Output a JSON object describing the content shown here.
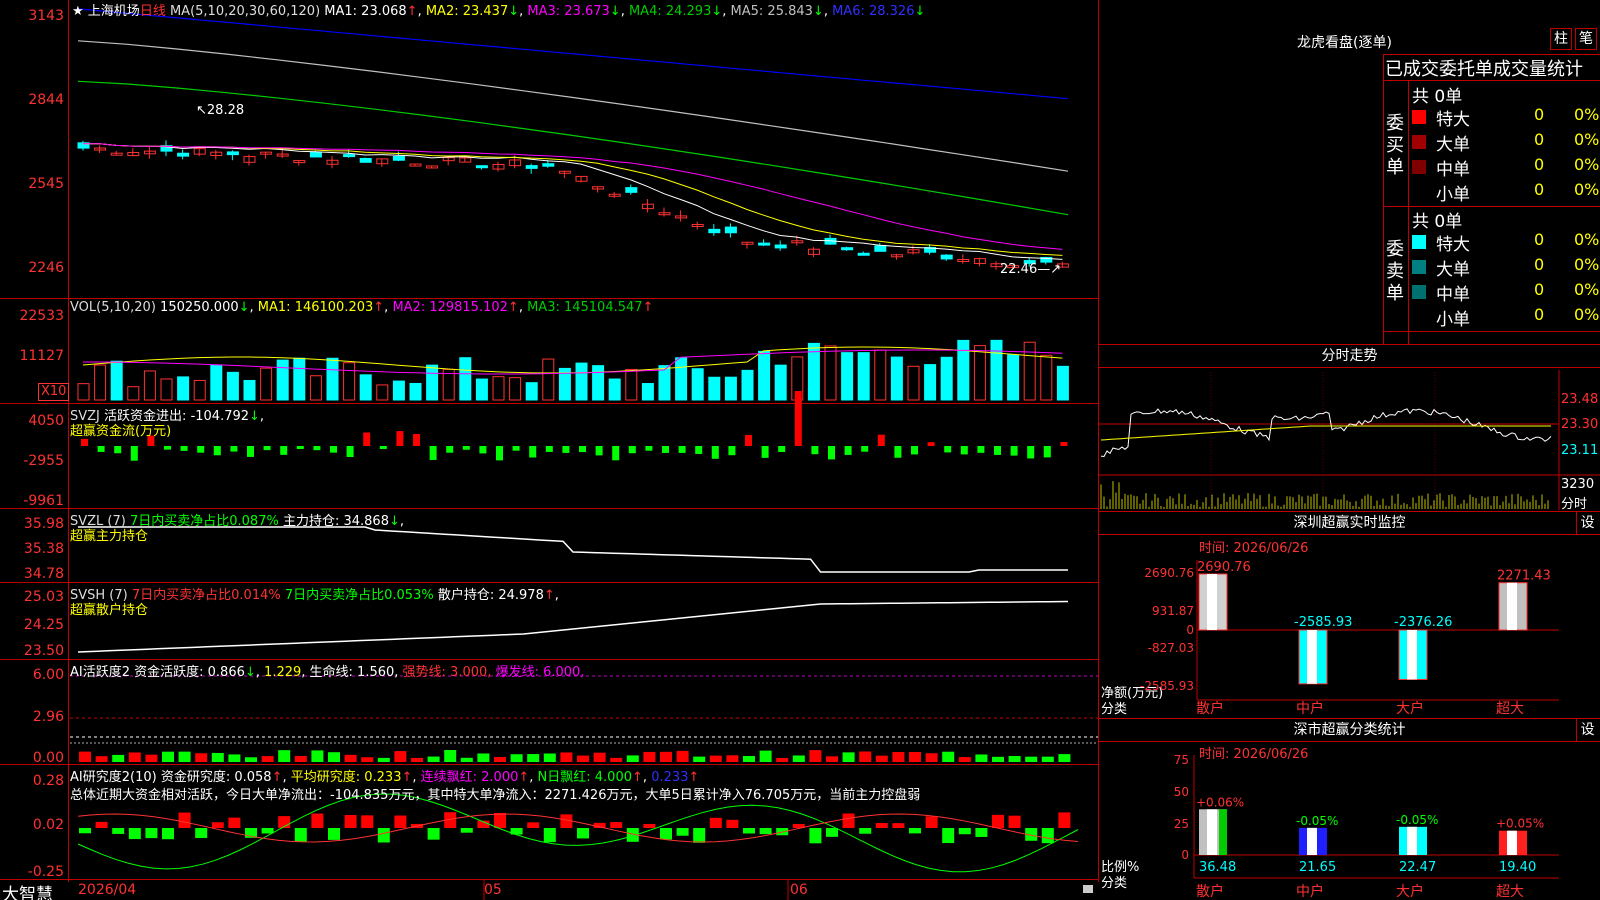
{
  "colors": {
    "up": "#ff3232",
    "down": "#00ffff",
    "grid": "#c00000",
    "ma1": "#ffffff",
    "ma2": "#ffff00",
    "ma3": "#ff00ff",
    "ma4": "#00cc00",
    "ma5": "#c0c0c0",
    "ma6": "#0000ff"
  },
  "main": {
    "star": "★",
    "stock": "上海机场",
    "period": "日线",
    "ma_title": "MA(5,10,20,30,60,120)",
    "ma1": "MA1: 23.068",
    "ma2": "MA2: 23.437",
    "ma3": "MA3: 23.673",
    "ma4": "MA4: 24.293",
    "ma5": "MA5: 25.843",
    "ma6": "MA6: 28.326",
    "y_labels": [
      "3143",
      "2844",
      "2545",
      "2246"
    ],
    "high_label": "28.28",
    "low_label": "22.46"
  },
  "vol": {
    "title": "VOL(5,10,20)",
    "value": "150250.000",
    "ma1": "MA1: 146100.203",
    "ma2": "MA2: 129815.102",
    "ma3": "MA3: 145104.547",
    "y_labels": [
      "22533",
      "11127"
    ],
    "unit": "X10"
  },
  "svzj": {
    "title": "SVZJ",
    "label": "活跃资金进出:",
    "value": "-104.792",
    "sub": "超赢资金流(万元)",
    "y_labels": [
      "4050",
      "-2955",
      "-9961"
    ]
  },
  "svzl": {
    "title": "SVZL (7)",
    "ratio": "7日内买卖净占比0.087%",
    "hold": "主力持仓: 34.868",
    "sub": "超赢主力持仓",
    "y_labels": [
      "35.98",
      "35.38",
      "34.78"
    ]
  },
  "svsh": {
    "title": "SVSH (7)",
    "ratio1": "7日内买卖净占比0.014%",
    "ratio2": "7日内买卖净占比0.053%",
    "hold": "散户持仓: 24.978",
    "sub": "超赢散户持仓",
    "y_labels": [
      "25.03",
      "24.25",
      "23.50"
    ]
  },
  "ai1": {
    "title": "AI活跃度2",
    "a": "资金活跃度: 0.866",
    "b": "1.229",
    "c": "生命线: 1.560,",
    "d": "强势线: 3.000,",
    "e": "爆发线: 6.000,",
    "y_labels": [
      "6.00",
      "2.96",
      "0.00"
    ]
  },
  "ai2": {
    "title": "AI研究度2(10)",
    "a": "资金研究度: 0.058",
    "b": "平均研究度: 0.233",
    "c": "连续飘红: 2.000",
    "d": "N日飘红: 4.000",
    "e": "0.233",
    "summary": "总体近期大资金相对活跃，今日大单净流出：-104.835万元，其中特大单净流入：2271.426万元，大单5日累计净入76.705万元，当前主力控盘弱",
    "y_labels": [
      "0.28",
      "0.02",
      "-0.25"
    ]
  },
  "xaxis": {
    "labels": [
      "2026/04",
      "05",
      "06"
    ]
  },
  "brand": "大智慧",
  "right": {
    "title": "龙虎看盘(逐单)",
    "btn1": "柱",
    "btn2": "笔",
    "table_title": "已成交委托单成交量统计",
    "buy_side": "委买单",
    "sell_side": "委卖单",
    "buy_count": "共 0单",
    "sell_count": "共 0单",
    "rows": [
      "特大",
      "大单",
      "中单",
      "小单"
    ],
    "zero": "0",
    "pct": "0%",
    "intraday_title": "分时走势",
    "intraday_y": [
      "23.48",
      "23.30",
      "23.11"
    ],
    "intraday_vol": [
      "3230",
      "分时"
    ],
    "sz_title": "深圳超赢实时监控",
    "sz_date": "时间: 2026/06/26",
    "sz_btn": "设",
    "sz_y": [
      "2690.76",
      "931.87",
      "0",
      "-827.03",
      "-2585.93"
    ],
    "sz_unit": [
      "净额(万元)",
      "分类"
    ],
    "sz_bars": [
      {
        "cat": "散户",
        "v": 2690.76,
        "label": "2690.76"
      },
      {
        "cat": "中户",
        "v": -2585.93,
        "label": "-2585.93"
      },
      {
        "cat": "大户",
        "v": -2376.26,
        "label": "-2376.26"
      },
      {
        "cat": "超大",
        "v": 2271.43,
        "label": "2271.43"
      }
    ],
    "cls_title": "深市超赢分类统计",
    "cls_date": "时间: 2026/06/26",
    "cls_btn": "设",
    "cls_y": [
      "75",
      "50",
      "25",
      "0"
    ],
    "cls_unit": [
      "比例%",
      "分类"
    ],
    "cls_bars": [
      {
        "cat": "散户",
        "v": 36.48,
        "chg": "+0.06%",
        "label": "36.48"
      },
      {
        "cat": "中户",
        "v": 21.65,
        "chg": "-0.05%",
        "label": "21.65"
      },
      {
        "cat": "大户",
        "v": 22.47,
        "chg": "-0.05%",
        "label": "22.47"
      },
      {
        "cat": "超大",
        "v": 19.4,
        "chg": "+0.05%",
        "label": "19.40"
      }
    ]
  }
}
